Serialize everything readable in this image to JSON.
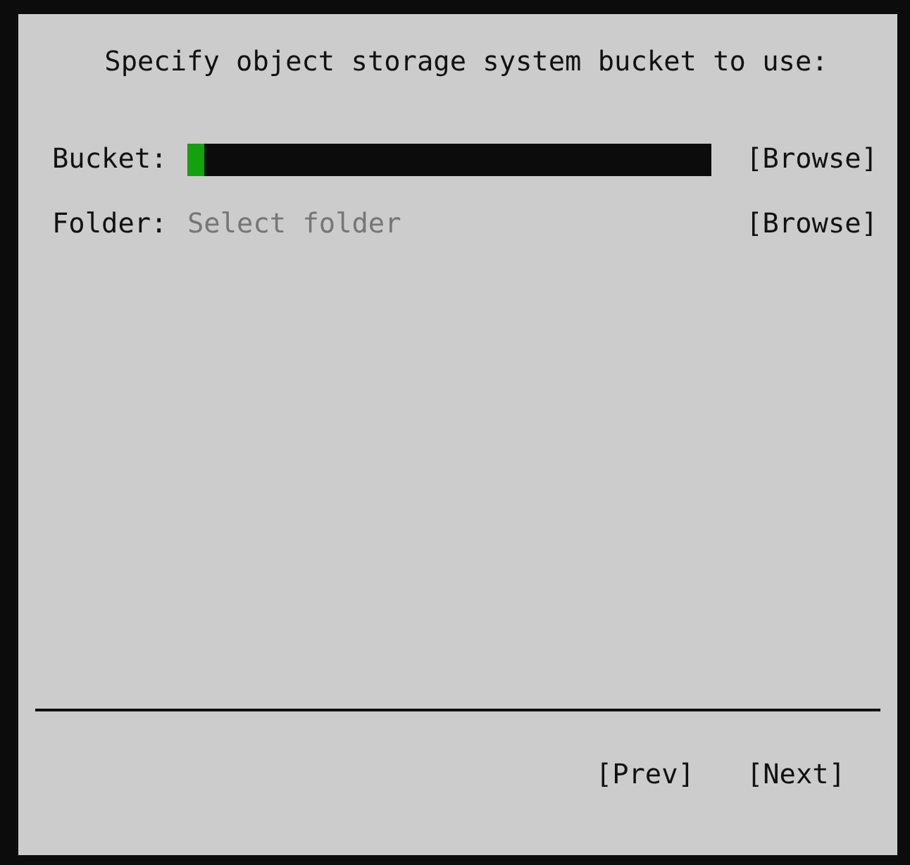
{
  "dialog": {
    "title": "Specify object storage system bucket to use:",
    "fields": [
      {
        "label": "Bucket:",
        "focused": true,
        "browse": "[Browse]"
      },
      {
        "label": "Folder:",
        "placeholder": "Select folder",
        "focused": false,
        "browse": "[Browse]"
      }
    ],
    "buttons": [
      "[Prev]",
      "[Next]"
    ]
  }
}
